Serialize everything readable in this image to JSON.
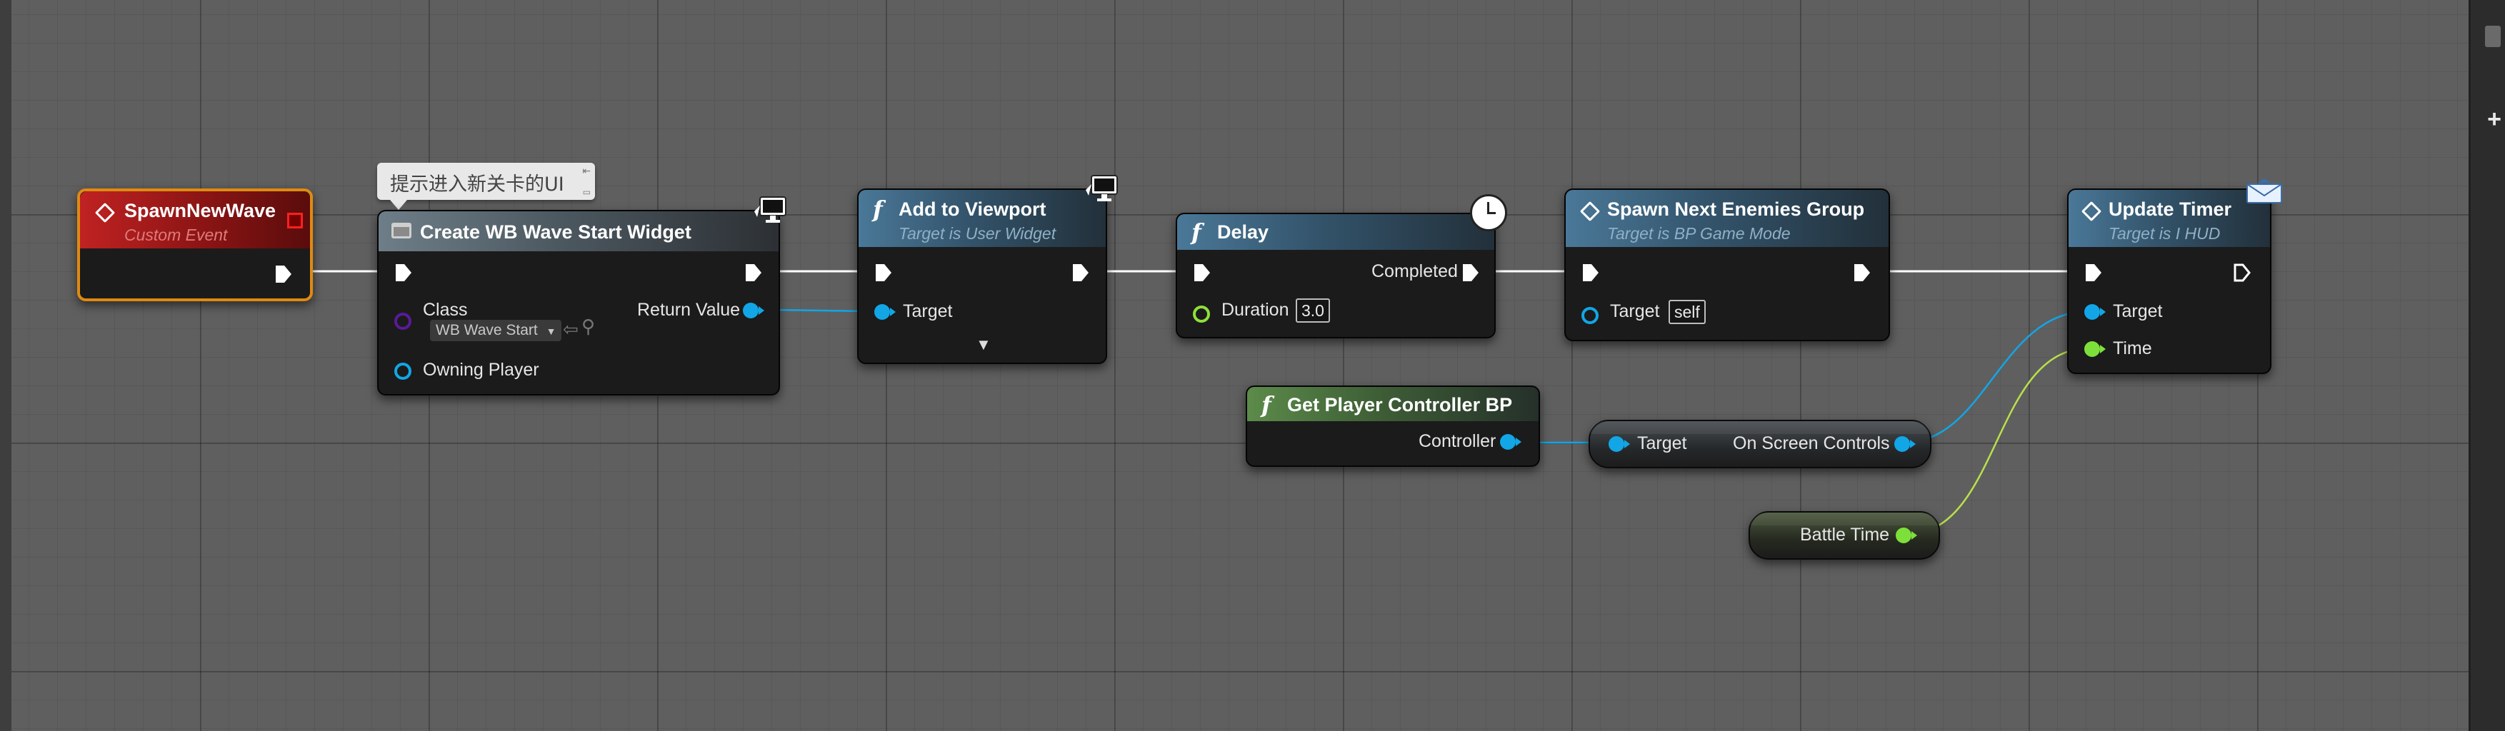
{
  "colors": {
    "exec": "#ffffff",
    "object_pin": "#12a6e6",
    "float_pin": "#7de03a",
    "class_pin": "#5a1a9a",
    "selection_border": "#e08a10"
  },
  "comment": {
    "text": "提示进入新关卡的UI"
  },
  "nodes": {
    "spawn_new_wave": {
      "title": "SpawnNewWave",
      "subtitle": "Custom Event"
    },
    "create_widget": {
      "title": "Create WB Wave Start Widget",
      "class_label": "Class",
      "class_value": "WB Wave Start",
      "return_label": "Return Value",
      "owning_player_label": "Owning Player"
    },
    "add_to_viewport": {
      "title": "Add to Viewport",
      "subtitle": "Target is User Widget",
      "target_label": "Target"
    },
    "delay": {
      "title": "Delay",
      "completed_label": "Completed",
      "duration_label": "Duration",
      "duration_value": "3.0"
    },
    "spawn_next_enemies": {
      "title": "Spawn Next Enemies Group",
      "subtitle": "Target is BP Game Mode",
      "target_label": "Target",
      "target_value": "self"
    },
    "update_timer": {
      "title": "Update Timer",
      "subtitle": "Target is I HUD",
      "target_label": "Target",
      "time_label": "Time"
    },
    "get_player_controller": {
      "title": "Get Player Controller BP",
      "controller_label": "Controller"
    },
    "on_screen_controls": {
      "target_label": "Target",
      "output_label": "On Screen Controls"
    },
    "battle_time": {
      "label": "Battle Time"
    }
  }
}
